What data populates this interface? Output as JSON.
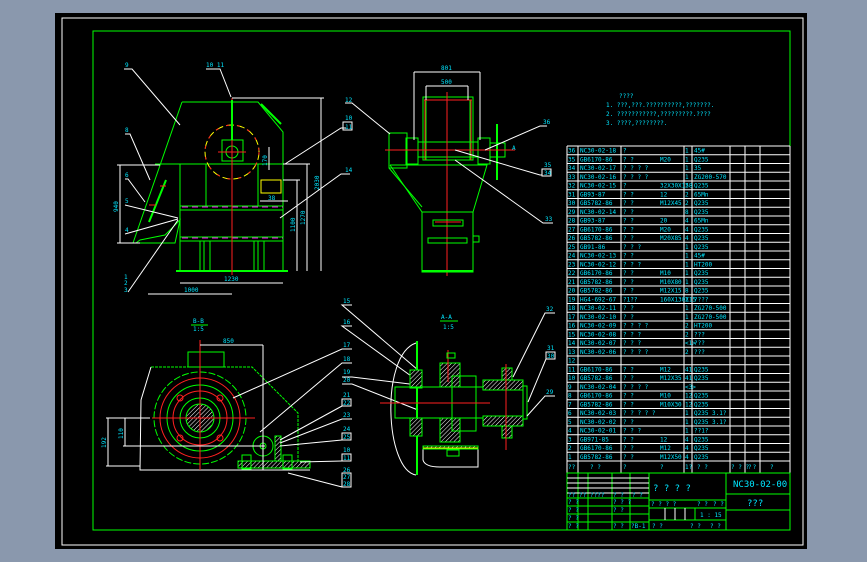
{
  "colors": {
    "background": "#8a98ad",
    "canvas": "#000000",
    "frame": "#ffffff",
    "outline": "#00ff00",
    "centerline": "#ff2020",
    "text": "#00e6ff",
    "highlight": "#ffff00",
    "hidden": "#ff00ff"
  },
  "front_view": {
    "dims": {
      "width": "1230",
      "offset": "1000",
      "height_total": "2030",
      "height_mid": "1270",
      "height_low": "1100",
      "height_left": "940",
      "small": "170",
      "small2": "38"
    },
    "callouts": {
      "c9": "9",
      "c10_11": "10 11",
      "c12": "12",
      "c10": "10",
      "c11": "11",
      "c14": "14",
      "c8": "8",
      "c6": "6",
      "c5": "5",
      "c4": "4",
      "c1": "1",
      "c2": "2",
      "c3": "3"
    }
  },
  "side_view": {
    "dims": {
      "outer": "801",
      "inner": "500"
    },
    "section_mark": "A",
    "callouts": {
      "c36": "36",
      "c35": "35",
      "c34": "34",
      "c33": "33"
    }
  },
  "section_bb": {
    "title": "B-B",
    "scale": "1:5",
    "dims": {
      "horizontal": "850",
      "vertical_outer": "192",
      "vertical_inner": "110"
    },
    "callouts": {
      "c15": "15",
      "c16": "16",
      "c17": "17",
      "c18": "18",
      "c19": "19",
      "c20": "20",
      "c21": "21",
      "c22": "22",
      "c23": "23",
      "c24": "24",
      "c25": "25",
      "c10": "10",
      "c11": "11",
      "c26": "26",
      "c27": "27",
      "c28": "28"
    }
  },
  "section_aa": {
    "title": "A-A",
    "scale": "1:5",
    "callouts": {
      "c32": "32",
      "c31": "31",
      "c30": "30",
      "c29": "29"
    }
  },
  "notes": {
    "heading": "????",
    "lines": [
      "1. ???,???.??????????,???????.",
      "2. ???????????,?????????.????",
      "3. ????,????????."
    ]
  },
  "parts_list": {
    "rows": [
      [
        "36",
        "NC30-02-18",
        "?",
        "",
        "1",
        "45#"
      ],
      [
        "35",
        "GB6170-86",
        "?   ?",
        "M20",
        "1",
        "Q235"
      ],
      [
        "34",
        "NC30-02-17",
        "? ? ? ?",
        "",
        "1",
        "35"
      ],
      [
        "33",
        "NC30-02-16",
        "? ? ? ?",
        "",
        "1",
        "ZG200-570"
      ],
      [
        "32",
        "NC30-02-15",
        "?",
        "32X30X158",
        "2",
        "Q235"
      ],
      [
        "31",
        "GB93-87",
        "?   ?",
        "12",
        "2",
        "65Mn"
      ],
      [
        "30",
        "GB5782-86",
        "?   ?",
        "M12X45",
        "2",
        "Q235"
      ],
      [
        "29",
        "NC30-02-14",
        "?   ?",
        "",
        "8",
        "Q235"
      ],
      [
        "28",
        "GB93-87",
        "?   ?",
        "20",
        "4",
        "65Mn"
      ],
      [
        "27",
        "GB6170-86",
        "?   ?",
        "M20",
        "4",
        "Q235"
      ],
      [
        "26",
        "GB5782-86",
        "?   ?",
        "M20X85",
        "4",
        "Q235"
      ],
      [
        "25",
        "GB91-86",
        "? ? ?",
        "",
        "1",
        "Q235"
      ],
      [
        "24",
        "NC30-02-13",
        "?   ?",
        "",
        "1",
        "45#"
      ],
      [
        "23",
        "NC30-02-12",
        "? ? ?",
        "",
        "1",
        "HT200"
      ],
      [
        "22",
        "GB6170-86",
        "?   ?",
        "M10",
        "1",
        "Q235"
      ],
      [
        "21",
        "GB5782-86",
        "?   ?",
        "M10X80",
        "1",
        "Q235"
      ],
      [
        "20",
        "GB5782-86",
        "?   ?",
        "M12X15",
        "8",
        "Q235"
      ],
      [
        "19",
        "HG4-692-67",
        "?1??",
        "160X130X15",
        "2",
        "????"
      ],
      [
        "18",
        "NC30-02-11",
        "?   ?",
        "",
        "1",
        "ZG270-500"
      ],
      [
        "17",
        "NC30-02-10",
        "?   ?",
        "",
        "1",
        "ZG270-500"
      ],
      [
        "16",
        "NC30-02-09",
        "? ? ? ?",
        "",
        "2",
        "HT200"
      ],
      [
        "15",
        "NC30-02-08",
        "? ? ?",
        "",
        "2",
        "???"
      ],
      [
        "14",
        "NC30-02-07",
        "? ? ?",
        "",
        "<1>",
        "???"
      ],
      [
        "13",
        "NC30-02-06",
        "? ? ? ?",
        "",
        "2",
        "???"
      ],
      [
        "12",
        "",
        "",
        "",
        "",
        ""
      ],
      [
        "11",
        "GB6170-86",
        "?   ?",
        "M12",
        "41",
        "Q235"
      ],
      [
        "10",
        "GB5782-86",
        "?   ?",
        "M12X35",
        "41",
        "Q235"
      ],
      [
        "9",
        "NC30-02-04",
        "? ? ? ?",
        "",
        "<3>",
        ""
      ],
      [
        "8",
        "GB6170-86",
        "?   ?",
        "M10",
        "12",
        "Q235"
      ],
      [
        "7",
        "GB5782-86",
        "?   ?",
        "M10X30",
        "12",
        "Q235"
      ],
      [
        "6",
        "NC30-02-03",
        "? ? ? ? ?",
        "",
        "1",
        "Q235  3.1?"
      ],
      [
        "5",
        "NC30-02-02",
        "?   ?",
        "",
        "1",
        "Q235  3.1?"
      ],
      [
        "4",
        "NC30-02-01",
        "? ? ?",
        "",
        "1",
        "??1?"
      ],
      [
        "3",
        "GB971-85",
        "?   ?",
        "12",
        "4",
        "Q235"
      ],
      [
        "2",
        "GB6170-86",
        "?   ?",
        "M12",
        "4",
        "Q235"
      ],
      [
        "1",
        "GB5782-86",
        "?   ?",
        "M12X50",
        "4",
        "Q235"
      ]
    ],
    "header": [
      "??",
      "?   ?",
      "?",
      "?",
      "1?",
      "?   ?",
      "? ? ? ?",
      "?",
      "?"
    ]
  },
  "title_block": {
    "drawing_title": "? ? ? ?",
    "drawing_number": "NC30-02-00",
    "company": "???",
    "scale": "1 : 15",
    "sheet": "?B-1",
    "cells": [
      "??",
      "??",
      "????",
      "?  ?",
      "? ?",
      "?  ?",
      "?  ?",
      "?  ?",
      "?  ?",
      "? ? ?",
      "? ?",
      "? ? ? ?",
      "? ?",
      "? ?",
      "? ?",
      "?  ?",
      "?  ?",
      "?  ?"
    ]
  }
}
